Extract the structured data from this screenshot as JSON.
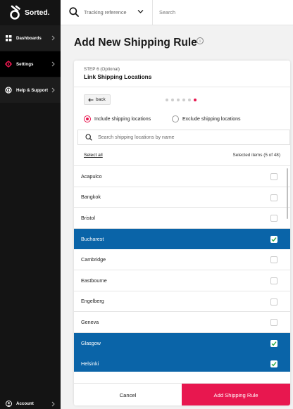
{
  "brand": {
    "name": "Sorted.",
    "accent": "#e8174f",
    "select_color": "#0a64a8"
  },
  "sidebar": {
    "items": [
      {
        "label": "Dashboards",
        "icon": "grid-icon"
      },
      {
        "label": "Settings",
        "icon": "gear-icon"
      },
      {
        "label": "Help & Support",
        "icon": "lifebuoy-icon"
      }
    ],
    "account": {
      "label": "Account",
      "icon": "user-icon"
    }
  },
  "topbar": {
    "tracking_label": "Tracking reference",
    "search_placeholder": "Search"
  },
  "page": {
    "title": "Add New Shipping Rule",
    "info_glyph": "i"
  },
  "step": {
    "label": "STEP 6 (Optional)",
    "title": "Link Shipping Locations",
    "back_label": "back",
    "total_steps": 6,
    "current_step": 6
  },
  "options": {
    "include_label": "Include shipping locations",
    "exclude_label": "Exclude shipping locations",
    "selected": "include"
  },
  "location_search": {
    "placeholder": "Search shipping locations by name"
  },
  "list_header": {
    "select_all": "Select all",
    "selected_count": "Selected items (5 of 48)"
  },
  "locations": [
    {
      "name": "Acapulco",
      "checked": false
    },
    {
      "name": "Bangkok",
      "checked": false
    },
    {
      "name": "Bristol",
      "checked": false
    },
    {
      "name": "Bucharest",
      "checked": true
    },
    {
      "name": "Cambridge",
      "checked": false
    },
    {
      "name": "Eastbourne",
      "checked": false
    },
    {
      "name": "Engelberg",
      "checked": false
    },
    {
      "name": "Geneva",
      "checked": false
    },
    {
      "name": "Glasgow",
      "checked": true
    },
    {
      "name": "Helsinki",
      "checked": true
    }
  ],
  "footer": {
    "cancel_label": "Cancel",
    "submit_label": "Add Shipping Rule"
  }
}
